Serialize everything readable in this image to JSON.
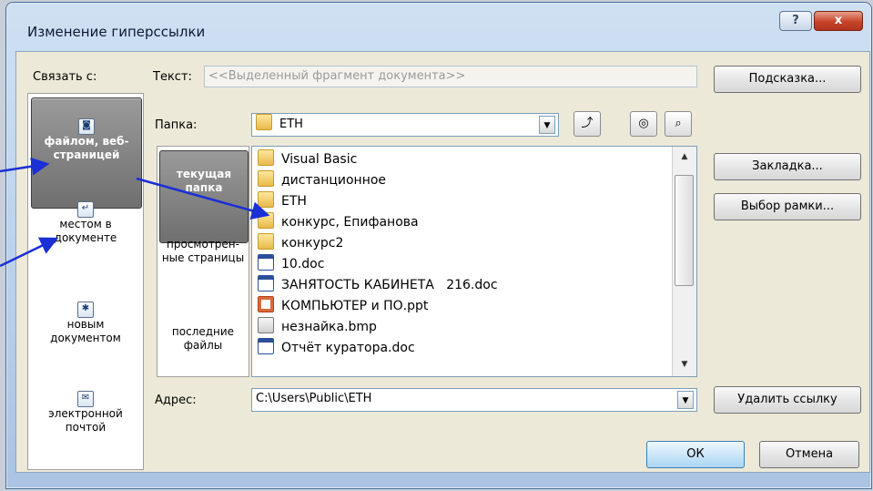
{
  "window": {
    "title": "Изменение гиперссылки",
    "help_label": "?",
    "close_label": "x"
  },
  "link_to": {
    "label": "Связать с:",
    "items": [
      {
        "icon": "web-page-file-icon",
        "label": "файлом, веб-страницей",
        "selected": true
      },
      {
        "icon": "document-place-icon",
        "label": "местом в документе",
        "selected": false
      },
      {
        "icon": "new-document-icon",
        "label": "новым документом",
        "selected": false
      },
      {
        "icon": "email-icon",
        "label": "электронной почтой",
        "selected": false
      }
    ]
  },
  "text_field": {
    "label": "Текст:",
    "value": "<<Выделенный фрагмент документа>>"
  },
  "folder": {
    "label": "Папка:",
    "value": "ETH"
  },
  "nav": {
    "items": [
      {
        "label": "текущая папка",
        "selected": true
      },
      {
        "label": "просмотрен-ные страницы",
        "selected": false
      },
      {
        "label": "последние файлы",
        "selected": false
      }
    ]
  },
  "files": [
    {
      "name": "Visual Basic",
      "type": "folder"
    },
    {
      "name": "дистанционное",
      "type": "folder"
    },
    {
      "name": "ETH",
      "type": "folder"
    },
    {
      "name": "конкурс, Епифанова",
      "type": "folder"
    },
    {
      "name": "конкурс2",
      "type": "folder"
    },
    {
      "name": "10.doc",
      "type": "doc"
    },
    {
      "name": "ЗАНЯТОСТЬ КАБИНЕТА   216.doc",
      "type": "doc"
    },
    {
      "name": "КОМПЬЮТЕР и ПО.ppt",
      "type": "ppt"
    },
    {
      "name": "незнайка.bmp",
      "type": "bmp"
    },
    {
      "name": "Отчёт куратора.doc",
      "type": "doc"
    }
  ],
  "address": {
    "label": "Адрес:",
    "value": "C:\\Users\\Public\\ETH"
  },
  "buttons": {
    "hint": "Подсказка...",
    "bookmark": "Закладка...",
    "frame": "Выбор рамки...",
    "remove_link": "Удалить ссылку",
    "ok": "ОК",
    "cancel": "Отмена"
  },
  "annotation_color": "#1a2fd6"
}
